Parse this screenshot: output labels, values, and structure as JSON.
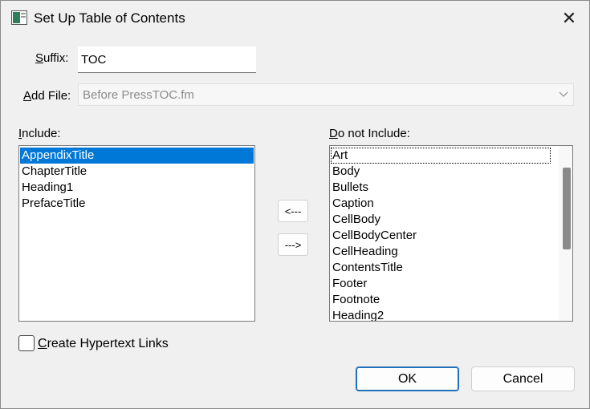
{
  "window": {
    "title": "Set Up Table of Contents",
    "close_glyph": "✕"
  },
  "suffix": {
    "label_key": "S",
    "label_rest": "uffix:",
    "value": "TOC"
  },
  "add_file": {
    "label_key": "A",
    "label_rest": "dd File:",
    "value": "Before PressTOC.fm",
    "chevron": "⌄"
  },
  "include": {
    "label_key": "I",
    "label_rest": "nclude:",
    "items": [
      "AppendixTitle",
      "ChapterTitle",
      "Heading1",
      "PrefaceTitle"
    ],
    "selected_index": 0
  },
  "exclude": {
    "label_key": "D",
    "label_rest": "o not Include:",
    "items": [
      "Art",
      "Body",
      "Bullets",
      "Caption",
      "CellBody",
      "CellBodyCenter",
      "CellHeading",
      "ContentsTitle",
      "Footer",
      "Footnote",
      "Heading2"
    ],
    "focused_index": 0
  },
  "move_left": {
    "label": "<---"
  },
  "move_right": {
    "label": "--->"
  },
  "hypertext": {
    "label_key": "C",
    "label_rest": "reate Hypertext Links",
    "checked": false
  },
  "buttons": {
    "ok": "OK",
    "cancel": "Cancel"
  },
  "colors": {
    "selection": "#0078d7",
    "default_button_border": "#1f6fb8"
  }
}
